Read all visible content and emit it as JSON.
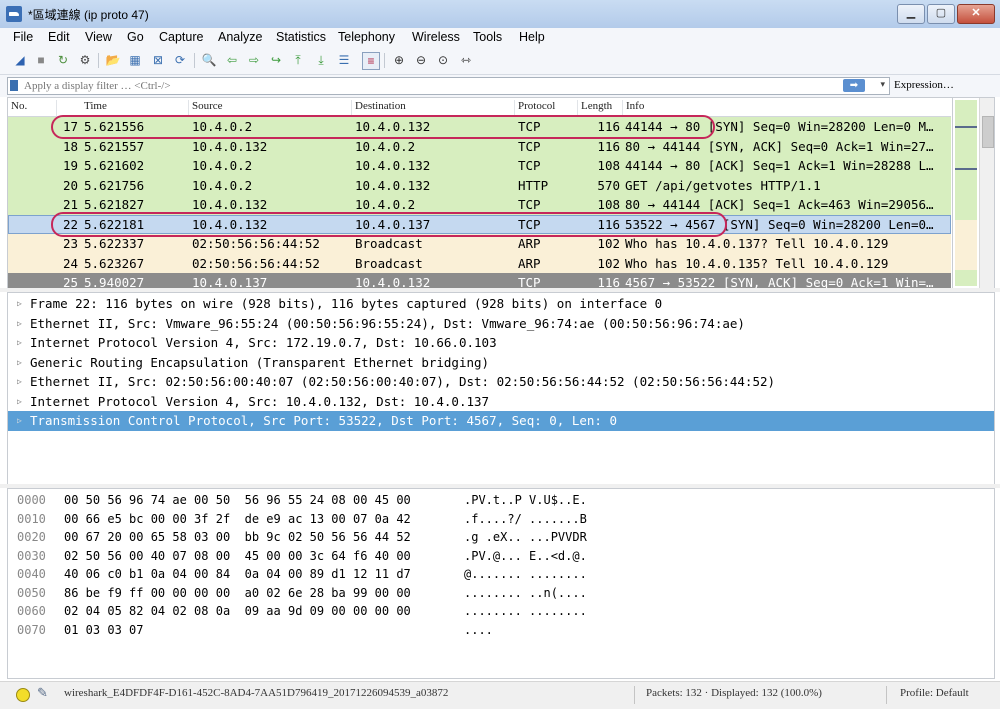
{
  "window": {
    "title": "*區域連線 (ip proto 47)",
    "min_glyph": "▁",
    "max_glyph": "▢",
    "close_glyph": "✕"
  },
  "menu": [
    "File",
    "Edit",
    "View",
    "Go",
    "Capture",
    "Analyze",
    "Statistics",
    "Telephony",
    "Wireless",
    "Tools",
    "Help"
  ],
  "toolbar": {
    "icons": [
      "shark-fin-start-icon",
      "stop-icon",
      "restart-icon",
      "capture-options-icon",
      "open-file-icon",
      "save-file-icon",
      "close-file-icon",
      "reload-icon",
      "find-icon",
      "go-back-icon",
      "go-forward-icon",
      "go-to-packet-icon",
      "go-first-icon",
      "go-last-icon",
      "autoscroll-icon",
      "colorize-icon",
      "zoom-in-icon",
      "zoom-out-icon",
      "zoom-normal-icon",
      "resize-columns-icon"
    ],
    "glyphs": [
      "◢",
      "■",
      "↻",
      "⚙",
      "📂",
      "▦",
      "⊠",
      "⟳",
      "🔍",
      "⇦",
      "⇨",
      "↪",
      "⤒",
      "⤓",
      "☰",
      "≡",
      "⊕",
      "⊖",
      "⊙",
      "⇿"
    ]
  },
  "filter": {
    "placeholder": "Apply a display filter … <Ctrl-/>",
    "value": "",
    "apply_glyph": "➡",
    "dropdown_glyph": "▾",
    "expression_label": "Expression…"
  },
  "columns": [
    "No.",
    "Time",
    "Source",
    "Destination",
    "Protocol",
    "Length",
    "Info"
  ],
  "packets": [
    {
      "no": "17",
      "time": "5.621556",
      "src": "10.4.0.2",
      "dst": "10.4.0.132",
      "proto": "TCP",
      "len": "116",
      "info": "44144 → 80 [SYN] Seq=0 Win=28200 Len=0 M…",
      "color": "#d7eebf"
    },
    {
      "no": "18",
      "time": "5.621557",
      "src": "10.4.0.132",
      "dst": "10.4.0.2",
      "proto": "TCP",
      "len": "116",
      "info": "80 → 44144 [SYN, ACK] Seq=0 Ack=1 Win=27…",
      "color": "#d7eebf"
    },
    {
      "no": "19",
      "time": "5.621602",
      "src": "10.4.0.2",
      "dst": "10.4.0.132",
      "proto": "TCP",
      "len": "108",
      "info": "44144 → 80 [ACK] Seq=1 Ack=1 Win=28288 L…",
      "color": "#d7eebf"
    },
    {
      "no": "20",
      "time": "5.621756",
      "src": "10.4.0.2",
      "dst": "10.4.0.132",
      "proto": "HTTP",
      "len": "570",
      "info": "GET /api/getvotes HTTP/1.1",
      "color": "#d7eebf"
    },
    {
      "no": "21",
      "time": "5.621827",
      "src": "10.4.0.132",
      "dst": "10.4.0.2",
      "proto": "TCP",
      "len": "108",
      "info": "80 → 44144 [ACK] Seq=1 Ack=463 Win=29056…",
      "color": "#d7eebf"
    },
    {
      "no": "22",
      "time": "5.622181",
      "src": "10.4.0.132",
      "dst": "10.4.0.137",
      "proto": "TCP",
      "len": "116",
      "info": "53522 → 4567 [SYN] Seq=0 Win=28200 Len=0…",
      "color": "#c5d9f0",
      "selected": true
    },
    {
      "no": "23",
      "time": "5.622337",
      "src": "02:50:56:56:44:52",
      "dst": "Broadcast",
      "proto": "ARP",
      "len": "102",
      "info": "Who has 10.4.0.137? Tell 10.4.0.129",
      "color": "#faf0d7"
    },
    {
      "no": "24",
      "time": "5.623267",
      "src": "02:50:56:56:44:52",
      "dst": "Broadcast",
      "proto": "ARP",
      "len": "102",
      "info": "Who has 10.4.0.135? Tell 10.4.0.129",
      "color": "#faf0d7"
    },
    {
      "no": "25",
      "time": "5.940027",
      "src": "10.4.0.137",
      "dst": "10.4.0.132",
      "proto": "TCP",
      "len": "116",
      "info": "4567 → 53522 [SYN, ACK] Seq=0 Ack=1 Win=…",
      "color": "#8c8c8c",
      "text_color": "#ffffff"
    }
  ],
  "details": [
    {
      "text": "Frame 22: 116 bytes on wire (928 bits), 116 bytes captured (928 bits) on interface 0"
    },
    {
      "text": "Ethernet II, Src: Vmware_96:55:24 (00:50:56:96:55:24), Dst: Vmware_96:74:ae (00:50:56:96:74:ae)"
    },
    {
      "text": "Internet Protocol Version 4, Src: 172.19.0.7, Dst: 10.66.0.103"
    },
    {
      "text": "Generic Routing Encapsulation (Transparent Ethernet bridging)"
    },
    {
      "text": "Ethernet II, Src: 02:50:56:00:40:07 (02:50:56:00:40:07), Dst: 02:50:56:56:44:52 (02:50:56:56:44:52)"
    },
    {
      "text": "Internet Protocol Version 4, Src: 10.4.0.132, Dst: 10.4.0.137"
    },
    {
      "text": "Transmission Control Protocol, Src Port: 53522, Dst Port: 4567, Seq: 0, Len: 0",
      "selected": true
    }
  ],
  "expander_glyph": "▷",
  "hex": [
    {
      "offset": "0000",
      "hex": "00 50 56 96 74 ae 00 50  56 96 55 24 08 00 45 00",
      "ascii": ".PV.t..P V.U$..E."
    },
    {
      "offset": "0010",
      "hex": "00 66 e5 bc 00 00 3f 2f  de e9 ac 13 00 07 0a 42",
      "ascii": ".f....?/ .......B"
    },
    {
      "offset": "0020",
      "hex": "00 67 20 00 65 58 03 00  bb 9c 02 50 56 56 44 52",
      "ascii": ".g .eX.. ...PVVDR"
    },
    {
      "offset": "0030",
      "hex": "02 50 56 00 40 07 08 00  45 00 00 3c 64 f6 40 00",
      "ascii": ".PV.@... E..<d.@."
    },
    {
      "offset": "0040",
      "hex": "40 06 c0 b1 0a 04 00 84  0a 04 00 89 d1 12 11 d7",
      "ascii": "@....... ........"
    },
    {
      "offset": "0050",
      "hex": "86 be f9 ff 00 00 00 00  a0 02 6e 28 ba 99 00 00",
      "ascii": "........ ..n(...."
    },
    {
      "offset": "0060",
      "hex": "02 04 05 82 04 02 08 0a  09 aa 9d 09 00 00 00 00",
      "ascii": "........ ........"
    },
    {
      "offset": "0070",
      "hex": "01 03 03 07",
      "ascii": "...."
    }
  ],
  "status": {
    "file": "wireshark_E4DFDF4F-D161-452C-8AD4-7AA51D796419_20171226094539_a03872",
    "packets": "Packets: 132 · Displayed: 132 (100.0%)",
    "profile": "Profile: Default",
    "edit_glyph": "✎"
  },
  "colors": {
    "accent": "#c6275a",
    "tcp_row": "#d7eebf",
    "arp_row": "#faf0d7",
    "selected_row": "#c5d9f0",
    "detail_selected": "#5a9fd6"
  }
}
